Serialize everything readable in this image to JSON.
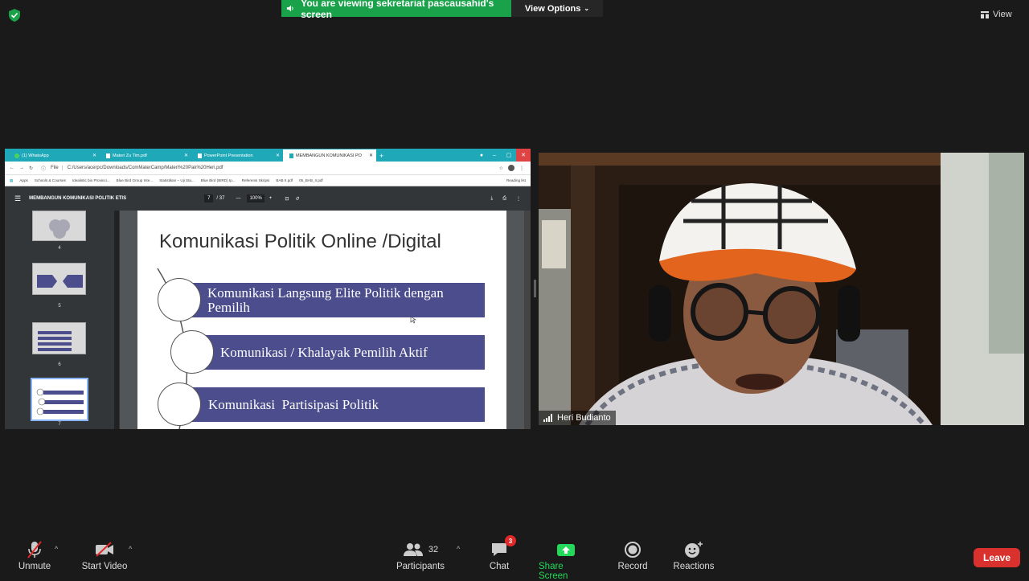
{
  "top": {
    "banner_text": "You are viewing sekretariat pascausahid's screen",
    "view_options": "View Options",
    "view_label": "View"
  },
  "browser": {
    "tabs": [
      "(1) WhatsApp",
      "Materi Zu Tim.pdf",
      "PowerPoint Presentation",
      "MEMBANGUN KOMUNIKASI PO"
    ],
    "address": "C:/Users/acerpc/Downloads/ComMaterCamp/Materi%20Pak%20Heri.pdf",
    "address_prefix": "File",
    "bookmarks": [
      "Apps",
      "Schools & Courses",
      "Idealistic bio Provinci...",
      "Blue Bird Group Inte...",
      "Statistikan – Uji Sta...",
      "Blue Bird (BIRD) Ip...",
      "Referensi Skripsi",
      "BAB II.pdf",
      "05_BAB_II.pdf"
    ],
    "reading_list": "Reading list"
  },
  "pdf": {
    "doc_title": "MEMBANGUN KOMUNIKASI POLITIK ETIS",
    "page_current": "7",
    "page_total": "/ 37",
    "zoom": "100%",
    "thumb_numbers": [
      "4",
      "5",
      "6",
      "7"
    ]
  },
  "slide": {
    "title": "Komunikasi Politik Online /Digital",
    "items": [
      "Komunikasi Langsung Elite Politik dengan Pemilih",
      "Komunikasi / Khalayak Pemilih Aktif",
      "Komunikasi  Partisipasi Politik"
    ]
  },
  "video": {
    "participant_name": "Heri Budianto"
  },
  "toolbar": {
    "unmute": "Unmute",
    "start_video": "Start Video",
    "participants": "Participants",
    "participants_count": "32",
    "chat": "Chat",
    "chat_badge": "3",
    "share_screen": "Share Screen",
    "record": "Record",
    "reactions": "Reactions",
    "leave": "Leave"
  },
  "colors": {
    "banner": "#1aa24a",
    "share_screen": "#23d959",
    "leave": "#d9322e",
    "slide_bar": "#4b4d8c"
  }
}
